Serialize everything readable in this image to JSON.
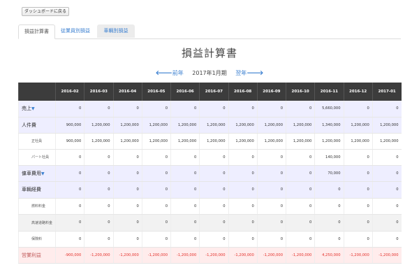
{
  "back_button": "ダッシュボードに戻る",
  "tabs": [
    {
      "label": "損益計算書"
    },
    {
      "label": "従業員別損益"
    },
    {
      "label": "車輌別損益"
    }
  ],
  "page_title": "損益計算書",
  "period_nav": {
    "prev": "前年",
    "current": "2017年1月期",
    "next": "翌年"
  },
  "table": {
    "months": [
      "2016-02",
      "2016-03",
      "2016-04",
      "2016-05",
      "2016-06",
      "2016-07",
      "2016-08",
      "2016-09",
      "2016-10",
      "2016-11",
      "2016-12",
      "2017-01"
    ],
    "rows": [
      {
        "label": "売上",
        "values": [
          "0",
          "0",
          "0",
          "0",
          "0",
          "0",
          "0",
          "0",
          "0",
          "5,660,000",
          "0",
          "0"
        ]
      },
      {
        "label": "人件費",
        "values": [
          "900,000",
          "1,200,000",
          "1,200,000",
          "1,200,000",
          "1,200,000",
          "1,200,000",
          "1,200,000",
          "1,200,000",
          "1,200,000",
          "1,340,000",
          "1,200,000",
          "1,200,000"
        ]
      },
      {
        "label": "正社員",
        "values": [
          "900,000",
          "1,200,000",
          "1,200,000",
          "1,200,000",
          "1,200,000",
          "1,200,000",
          "1,200,000",
          "1,200,000",
          "1,200,000",
          "1,200,000",
          "1,200,000",
          "1,200,000"
        ]
      },
      {
        "label": "パート社員",
        "values": [
          "0",
          "0",
          "0",
          "0",
          "0",
          "0",
          "0",
          "0",
          "0",
          "140,000",
          "0",
          "0"
        ]
      },
      {
        "label": "傭車費用",
        "values": [
          "0",
          "0",
          "0",
          "0",
          "0",
          "0",
          "0",
          "0",
          "0",
          "70,000",
          "0",
          "0"
        ]
      },
      {
        "label": "車輌経費",
        "values": [
          "0",
          "0",
          "0",
          "0",
          "0",
          "0",
          "0",
          "0",
          "0",
          "0",
          "0",
          "0"
        ]
      },
      {
        "label": "燃料料金",
        "values": [
          "0",
          "0",
          "0",
          "0",
          "0",
          "0",
          "0",
          "0",
          "0",
          "0",
          "0",
          "0"
        ]
      },
      {
        "label": "高速道路料金",
        "values": [
          "0",
          "0",
          "0",
          "0",
          "0",
          "0",
          "0",
          "0",
          "0",
          "0",
          "0",
          "0"
        ]
      },
      {
        "label": "保険料",
        "values": [
          "0",
          "0",
          "0",
          "0",
          "0",
          "0",
          "0",
          "0",
          "0",
          "0",
          "0",
          "0"
        ]
      },
      {
        "label": "営業利益",
        "values": [
          "-900,000",
          "-1,200,000",
          "-1,200,000",
          "-1,200,000",
          "-1,200,000",
          "-1,200,000",
          "-1,200,000",
          "-1,200,000",
          "-1,200,000",
          "4,250,000",
          "-1,200,000",
          "-1,200,000"
        ]
      }
    ]
  }
}
